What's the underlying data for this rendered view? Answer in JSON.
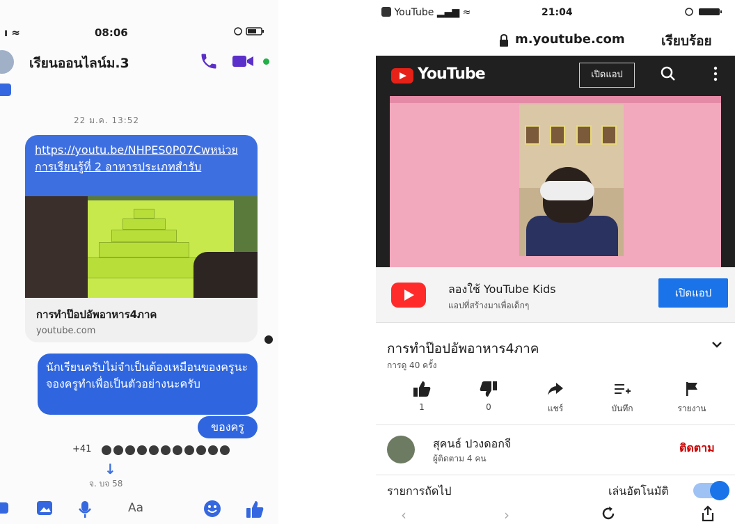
{
  "messenger": {
    "status": {
      "time": "08:06"
    },
    "chat_title": "เรียนออนไลน์ม.3",
    "date_label": "22 ม.ค. 13:52",
    "link_message": {
      "text": "https://youtu.be/NHPES0P07Cwหน่วยการเรียนรู้ที่ 2 อาหารประเภทสำรับ",
      "preview_title": "การทำป๊อปอัพอาหาร4ภาค",
      "preview_domain": "youtube.com"
    },
    "message_1": "นักเรียนครับไม่จำเป็นต้องเหมือนของครูนะจองครูทำเพื่อเป็นตัวอย่างนะครับ",
    "message_2": "ของครู",
    "reactions_count": "+41",
    "timestamp_2": "จ. บจ 58",
    "composer_placeholder": "Aa"
  },
  "youtube": {
    "status": {
      "back_app": "YouTube",
      "time": "21:04"
    },
    "url": "m.youtube.com",
    "done_label": "เรียบร้อย",
    "logo_text": "YouTube",
    "open_app_top": "เปิดแอป",
    "kids_banner": {
      "title": "ลองใช้ YouTube Kids",
      "subtitle": "แอปที่สร้างมาเพื่อเด็กๆ",
      "button": "เปิดแอป"
    },
    "video_title": "การทำป๊อปอัพอาหาร4ภาค",
    "views": "การดู 40 ครั้ง",
    "actions": [
      {
        "label": "1",
        "icon": "thumbs-up-icon"
      },
      {
        "label": "0",
        "icon": "thumbs-down-icon"
      },
      {
        "label": "แชร์",
        "icon": "share-icon"
      },
      {
        "label": "บันทึก",
        "icon": "save-playlist-icon"
      },
      {
        "label": "รายงาน",
        "icon": "flag-icon"
      }
    ],
    "channel": {
      "name": "สุคนธ์ ปวงดอกจี",
      "subscribers": "ผู้ติดตาม 4 คน",
      "subscribe_label": "ติดตาม"
    },
    "up_next_label": "รายการถัดไป",
    "autoplay_label": "เล่นอัตโนมัติ",
    "autoplay_on": true
  },
  "colors": {
    "messenger_blue": "#2f66df",
    "youtube_red": "#e62117",
    "youtube_dark": "#202020",
    "subscribe_red": "#cc0000",
    "pink_frame": "#f2a8bd"
  }
}
